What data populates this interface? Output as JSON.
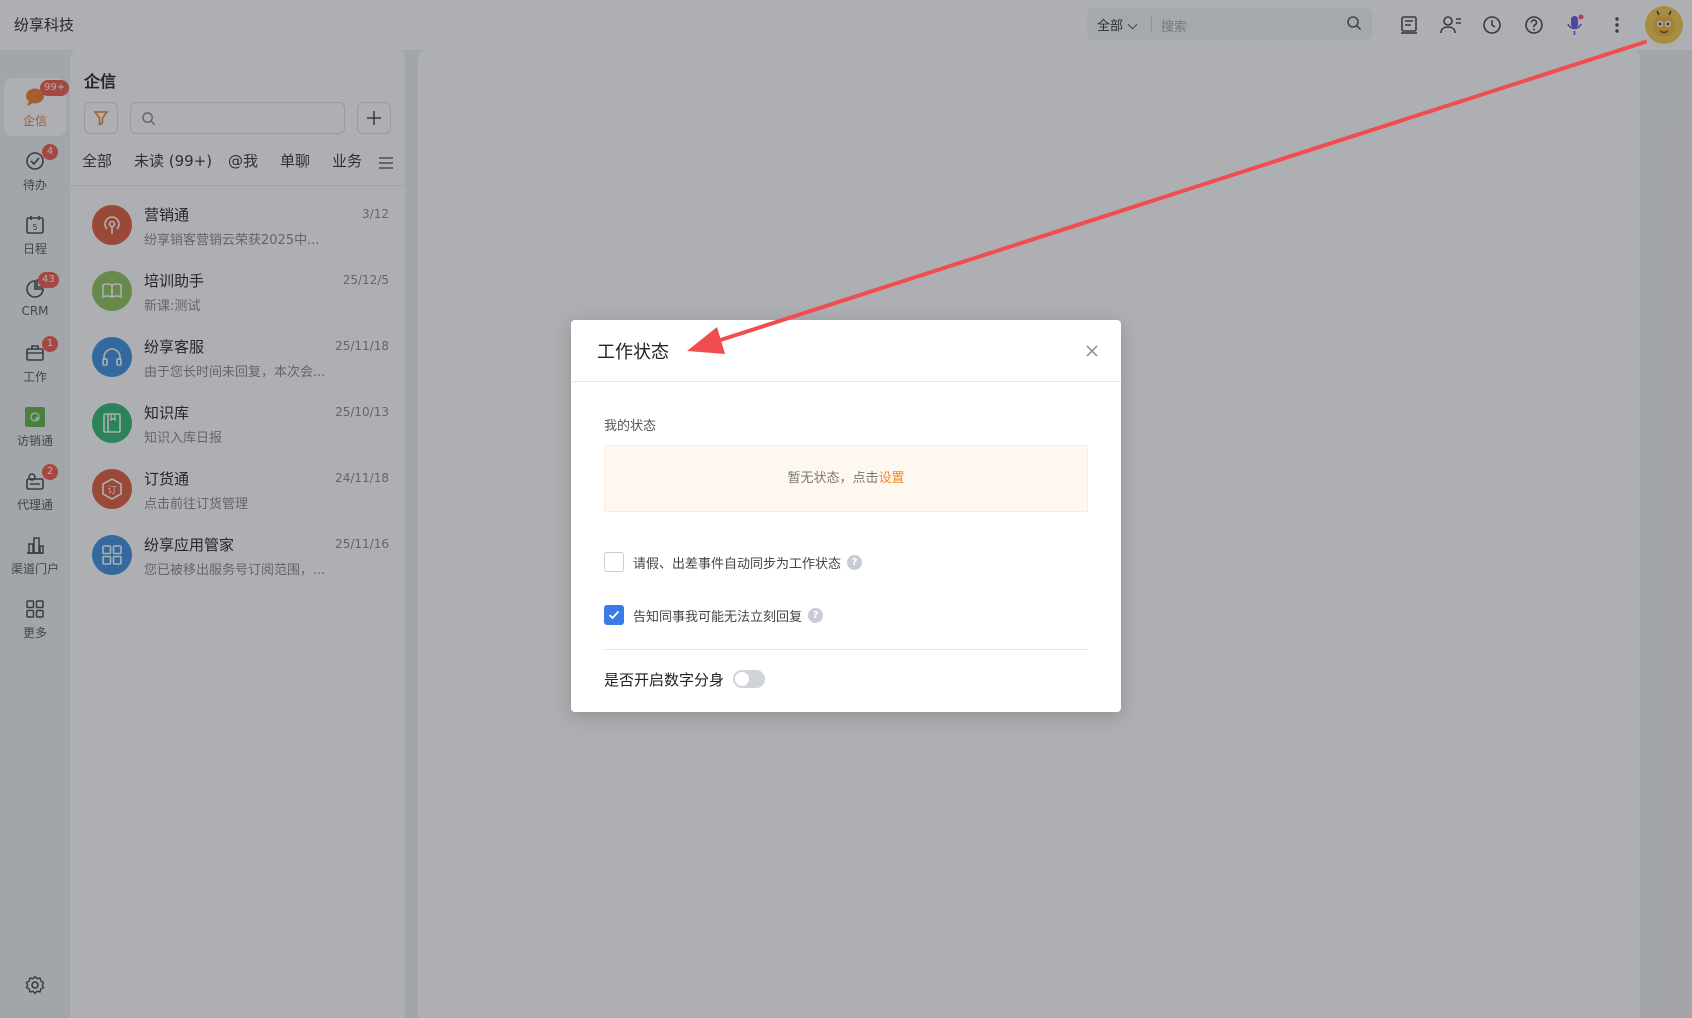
{
  "app": {
    "title": "纷享科技"
  },
  "search": {
    "scope": "全部",
    "placeholder": "搜索"
  },
  "topbar_icons": [
    "notes-icon",
    "contacts-icon",
    "clock-icon",
    "help-icon",
    "voice-assistant-icon",
    "more-icon",
    "user-avatar"
  ],
  "nav": {
    "items": [
      {
        "label": "企信",
        "icon": "chat-bubble-icon",
        "badge": "99+",
        "active": true
      },
      {
        "label": "待办",
        "icon": "check-circle-icon",
        "badge": "4"
      },
      {
        "label": "日程",
        "icon": "calendar-icon",
        "badge": ""
      },
      {
        "label": "CRM",
        "icon": "pie-chart-icon",
        "badge": "43"
      },
      {
        "label": "工作",
        "icon": "briefcase-icon",
        "badge": "1"
      },
      {
        "label": "访销通",
        "icon": "visit-sales-app-icon",
        "badge": ""
      },
      {
        "label": "代理通",
        "icon": "agent-icon",
        "badge": "2"
      },
      {
        "label": "渠道门户",
        "icon": "channel-portal-icon",
        "badge": ""
      },
      {
        "label": "更多",
        "icon": "grid-icon",
        "badge": ""
      }
    ]
  },
  "panel": {
    "title": "企信",
    "tabs": [
      "全部",
      "未读 (99+)",
      "@我",
      "单聊",
      "业务"
    ],
    "conversations": [
      {
        "name": "营销通",
        "time": "3/12",
        "preview": "纷享销客营销云荣获2025中...",
        "color": "#e05a3a",
        "icon": "broadcast-icon"
      },
      {
        "name": "培训助手",
        "time": "25/12/5",
        "preview": "新课:测试",
        "color": "#8fc45a",
        "icon": "book-icon"
      },
      {
        "name": "纷享客服",
        "time": "25/11/18",
        "preview": "由于您长时间未回复，本次会...",
        "color": "#3a8ee0",
        "icon": "headset-icon"
      },
      {
        "name": "知识库",
        "time": "25/10/13",
        "preview": "知识入库日报",
        "color": "#2eb872",
        "icon": "knowledge-book-icon"
      },
      {
        "name": "订货通",
        "time": "24/11/18",
        "preview": "点击前往订货管理",
        "color": "#e05a3a",
        "icon": "order-icon"
      },
      {
        "name": "纷享应用管家",
        "time": "25/11/16",
        "preview": "您已被移出服务号订阅范围，...",
        "color": "#3a8ee0",
        "icon": "apps-icon"
      }
    ]
  },
  "dialog": {
    "title": "工作状态",
    "my_status_label": "我的状态",
    "status_empty_text": "暂无状态，点击",
    "status_link": "设置",
    "checkbox1": {
      "label": "请假、出差事件自动同步为工作状态",
      "checked": false
    },
    "checkbox2": {
      "label": "告知同事我可能无法立刻回复",
      "checked": true
    },
    "digital_human_label": "是否开启数字分身",
    "digital_human_on": false
  },
  "colors": {
    "accent_orange": "#f07b2a",
    "checkbox_blue": "#3b7be8",
    "badge_red": "#f05a4a",
    "annotation_arrow": "#f04e4e"
  }
}
